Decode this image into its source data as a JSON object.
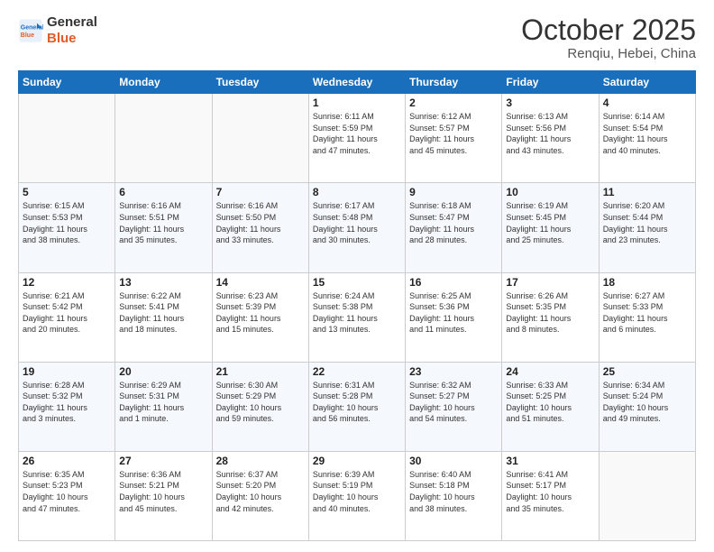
{
  "logo": {
    "line1": "General",
    "line2": "Blue"
  },
  "title": "October 2025",
  "subtitle": "Renqiu, Hebei, China",
  "weekdays": [
    "Sunday",
    "Monday",
    "Tuesday",
    "Wednesday",
    "Thursday",
    "Friday",
    "Saturday"
  ],
  "rows": [
    [
      {
        "day": "",
        "info": ""
      },
      {
        "day": "",
        "info": ""
      },
      {
        "day": "",
        "info": ""
      },
      {
        "day": "1",
        "info": "Sunrise: 6:11 AM\nSunset: 5:59 PM\nDaylight: 11 hours\nand 47 minutes."
      },
      {
        "day": "2",
        "info": "Sunrise: 6:12 AM\nSunset: 5:57 PM\nDaylight: 11 hours\nand 45 minutes."
      },
      {
        "day": "3",
        "info": "Sunrise: 6:13 AM\nSunset: 5:56 PM\nDaylight: 11 hours\nand 43 minutes."
      },
      {
        "day": "4",
        "info": "Sunrise: 6:14 AM\nSunset: 5:54 PM\nDaylight: 11 hours\nand 40 minutes."
      }
    ],
    [
      {
        "day": "5",
        "info": "Sunrise: 6:15 AM\nSunset: 5:53 PM\nDaylight: 11 hours\nand 38 minutes."
      },
      {
        "day": "6",
        "info": "Sunrise: 6:16 AM\nSunset: 5:51 PM\nDaylight: 11 hours\nand 35 minutes."
      },
      {
        "day": "7",
        "info": "Sunrise: 6:16 AM\nSunset: 5:50 PM\nDaylight: 11 hours\nand 33 minutes."
      },
      {
        "day": "8",
        "info": "Sunrise: 6:17 AM\nSunset: 5:48 PM\nDaylight: 11 hours\nand 30 minutes."
      },
      {
        "day": "9",
        "info": "Sunrise: 6:18 AM\nSunset: 5:47 PM\nDaylight: 11 hours\nand 28 minutes."
      },
      {
        "day": "10",
        "info": "Sunrise: 6:19 AM\nSunset: 5:45 PM\nDaylight: 11 hours\nand 25 minutes."
      },
      {
        "day": "11",
        "info": "Sunrise: 6:20 AM\nSunset: 5:44 PM\nDaylight: 11 hours\nand 23 minutes."
      }
    ],
    [
      {
        "day": "12",
        "info": "Sunrise: 6:21 AM\nSunset: 5:42 PM\nDaylight: 11 hours\nand 20 minutes."
      },
      {
        "day": "13",
        "info": "Sunrise: 6:22 AM\nSunset: 5:41 PM\nDaylight: 11 hours\nand 18 minutes."
      },
      {
        "day": "14",
        "info": "Sunrise: 6:23 AM\nSunset: 5:39 PM\nDaylight: 11 hours\nand 15 minutes."
      },
      {
        "day": "15",
        "info": "Sunrise: 6:24 AM\nSunset: 5:38 PM\nDaylight: 11 hours\nand 13 minutes."
      },
      {
        "day": "16",
        "info": "Sunrise: 6:25 AM\nSunset: 5:36 PM\nDaylight: 11 hours\nand 11 minutes."
      },
      {
        "day": "17",
        "info": "Sunrise: 6:26 AM\nSunset: 5:35 PM\nDaylight: 11 hours\nand 8 minutes."
      },
      {
        "day": "18",
        "info": "Sunrise: 6:27 AM\nSunset: 5:33 PM\nDaylight: 11 hours\nand 6 minutes."
      }
    ],
    [
      {
        "day": "19",
        "info": "Sunrise: 6:28 AM\nSunset: 5:32 PM\nDaylight: 11 hours\nand 3 minutes."
      },
      {
        "day": "20",
        "info": "Sunrise: 6:29 AM\nSunset: 5:31 PM\nDaylight: 11 hours\nand 1 minute."
      },
      {
        "day": "21",
        "info": "Sunrise: 6:30 AM\nSunset: 5:29 PM\nDaylight: 10 hours\nand 59 minutes."
      },
      {
        "day": "22",
        "info": "Sunrise: 6:31 AM\nSunset: 5:28 PM\nDaylight: 10 hours\nand 56 minutes."
      },
      {
        "day": "23",
        "info": "Sunrise: 6:32 AM\nSunset: 5:27 PM\nDaylight: 10 hours\nand 54 minutes."
      },
      {
        "day": "24",
        "info": "Sunrise: 6:33 AM\nSunset: 5:25 PM\nDaylight: 10 hours\nand 51 minutes."
      },
      {
        "day": "25",
        "info": "Sunrise: 6:34 AM\nSunset: 5:24 PM\nDaylight: 10 hours\nand 49 minutes."
      }
    ],
    [
      {
        "day": "26",
        "info": "Sunrise: 6:35 AM\nSunset: 5:23 PM\nDaylight: 10 hours\nand 47 minutes."
      },
      {
        "day": "27",
        "info": "Sunrise: 6:36 AM\nSunset: 5:21 PM\nDaylight: 10 hours\nand 45 minutes."
      },
      {
        "day": "28",
        "info": "Sunrise: 6:37 AM\nSunset: 5:20 PM\nDaylight: 10 hours\nand 42 minutes."
      },
      {
        "day": "29",
        "info": "Sunrise: 6:39 AM\nSunset: 5:19 PM\nDaylight: 10 hours\nand 40 minutes."
      },
      {
        "day": "30",
        "info": "Sunrise: 6:40 AM\nSunset: 5:18 PM\nDaylight: 10 hours\nand 38 minutes."
      },
      {
        "day": "31",
        "info": "Sunrise: 6:41 AM\nSunset: 5:17 PM\nDaylight: 10 hours\nand 35 minutes."
      },
      {
        "day": "",
        "info": ""
      }
    ]
  ]
}
